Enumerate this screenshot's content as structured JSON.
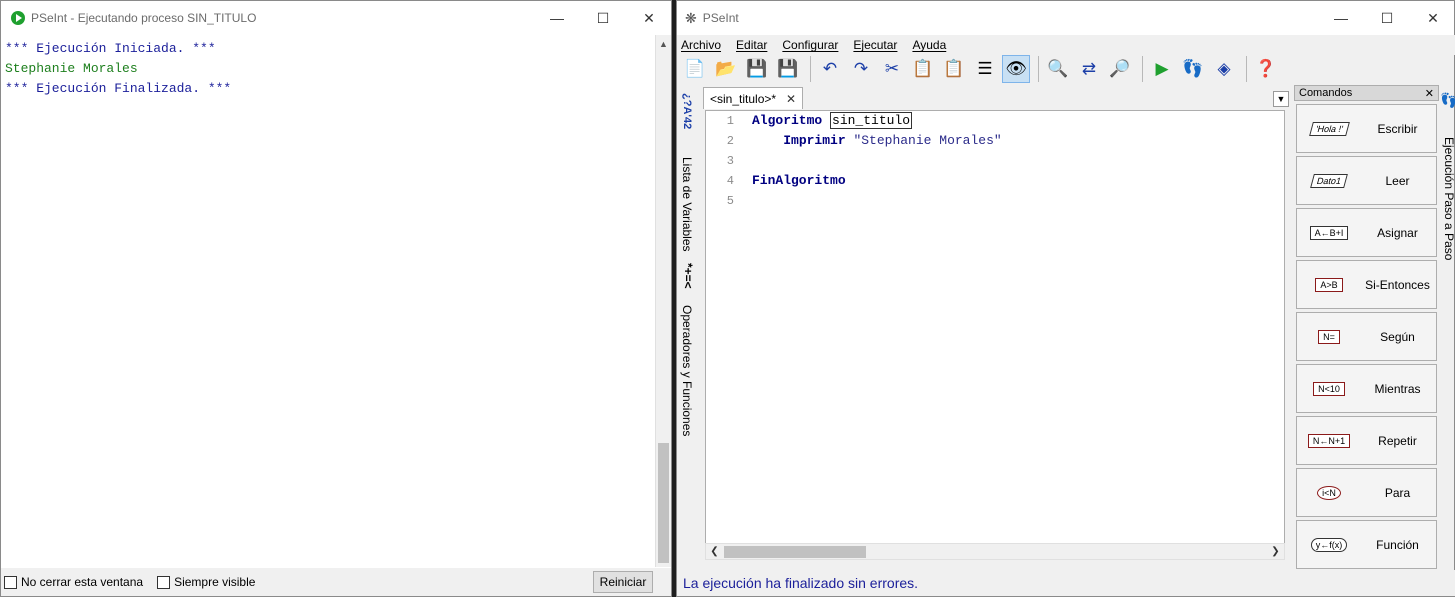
{
  "console": {
    "title": "PSeInt - Ejecutando proceso SIN_TITULO",
    "lines": [
      {
        "text": "*** Ejecución Iniciada. ***",
        "color": "#1b1f9a"
      },
      {
        "text": "Stephanie Morales",
        "color": "#1d7f1d"
      },
      {
        "text": "*** Ejecución Finalizada. ***",
        "color": "#1b1f9a"
      }
    ],
    "no_cerrar_label": "No cerrar esta ventana",
    "siempre_visible_label": "Siempre visible",
    "reiniciar_label": "Reiniciar"
  },
  "pseint": {
    "title": "PSeInt",
    "menu": [
      "Archivo",
      "Editar",
      "Configurar",
      "Ejecutar",
      "Ayuda"
    ],
    "tab_label": "<sin_titulo>*",
    "side_left": {
      "variables_label": "Lista de Variables",
      "variables_icon_text": "*+=<",
      "operadores_label": "Operadores y Funciones"
    },
    "code": {
      "line_numbers": [
        "1",
        "2",
        "3",
        "4",
        "5"
      ],
      "line1_kw": "Algoritmo",
      "line1_name": "sin_titulo",
      "line2_kw": "Imprimir",
      "line2_str": "\"Stephanie Morales\"",
      "line4_kw": "FinAlgoritmo"
    },
    "commands": {
      "header": "Comandos",
      "items": [
        {
          "label": "Escribir",
          "glyph": "'Hola !'"
        },
        {
          "label": "Leer",
          "glyph": "Dato1"
        },
        {
          "label": "Asignar",
          "glyph": "A←B+I"
        },
        {
          "label": "Si-Entonces",
          "glyph": "A>B"
        },
        {
          "label": "Según",
          "glyph": "N="
        },
        {
          "label": "Mientras",
          "glyph": "N<10"
        },
        {
          "label": "Repetir",
          "glyph": "N←N+1"
        },
        {
          "label": "Para",
          "glyph": "i<N"
        },
        {
          "label": "Función",
          "glyph": "y←f(x)"
        }
      ]
    },
    "side_right_label": "Ejecución Paso a Paso",
    "status": "La ejecución ha finalizado sin errores."
  }
}
